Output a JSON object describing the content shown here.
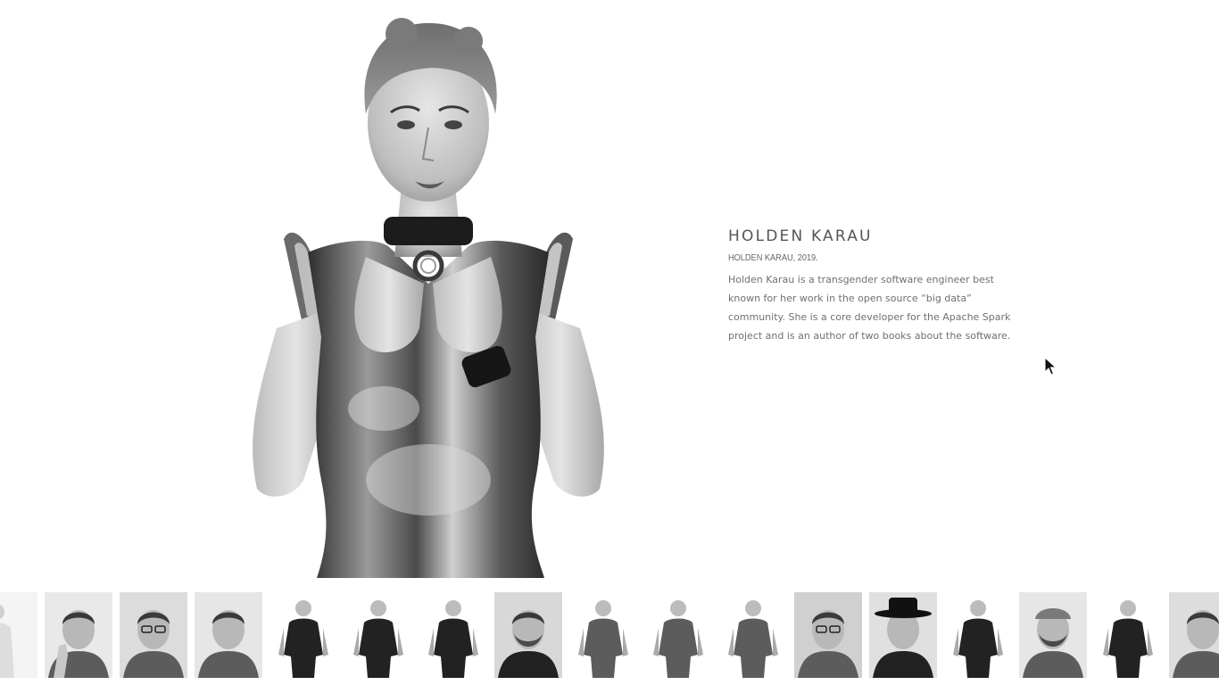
{
  "caption": {
    "name": "HOLDEN KARAU",
    "subtitle": "HOLDEN KARAU, 2019.",
    "bio": "Holden Karau is a transgender software engineer best known for her work in the open source “big data” community. She is a core developer for the Apache Spark project and is an author of two books about the software."
  },
  "hero": {
    "icon": "portrait-photo",
    "style": "black-and-white"
  },
  "thumbnails": [
    {
      "tone": "light",
      "bg": "#f4f4f4",
      "kind": "seated"
    },
    {
      "tone": "mid",
      "bg": "#e9e9e9",
      "kind": "hand-on-face"
    },
    {
      "tone": "mid",
      "bg": "#dcdcdc",
      "kind": "glasses"
    },
    {
      "tone": "mid",
      "bg": "#e6e6e6",
      "kind": "bald"
    },
    {
      "tone": "dark",
      "bg": "#ffffff",
      "kind": "standing"
    },
    {
      "tone": "dark",
      "bg": "#ffffff",
      "kind": "standing"
    },
    {
      "tone": "dark",
      "bg": "#ffffff",
      "kind": "suit"
    },
    {
      "tone": "dark",
      "bg": "#d8d8d8",
      "kind": "beard"
    },
    {
      "tone": "mid",
      "bg": "#ffffff",
      "kind": "standing"
    },
    {
      "tone": "mid",
      "bg": "#ffffff",
      "kind": "standing"
    },
    {
      "tone": "mid",
      "bg": "#ffffff",
      "kind": "standing"
    },
    {
      "tone": "mid",
      "bg": "#d0d0d0",
      "kind": "glasses"
    },
    {
      "tone": "dark",
      "bg": "#e0e0e0",
      "kind": "hat"
    },
    {
      "tone": "dark",
      "bg": "#ffffff",
      "kind": "standing"
    },
    {
      "tone": "mid",
      "bg": "#e6e6e6",
      "kind": "cap"
    },
    {
      "tone": "dark",
      "bg": "#ffffff",
      "kind": "standing"
    },
    {
      "tone": "mid",
      "bg": "#dddddd",
      "kind": "partial"
    }
  ],
  "cursor": {
    "icon": "arrow-cursor-icon"
  }
}
